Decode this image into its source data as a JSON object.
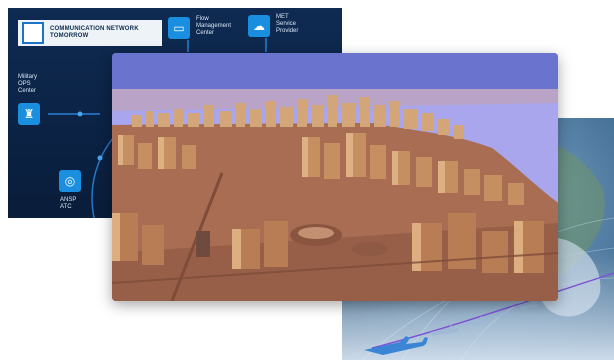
{
  "network_panel": {
    "header_line1": "COMMUNICATION NETWORK",
    "header_line2": "TOMORROW",
    "nodes": [
      {
        "label_lines": [
          "Flow",
          "Management",
          "Center"
        ],
        "icon": "monitor-icon"
      },
      {
        "label_lines": [
          "MET",
          "Service",
          "Provider"
        ],
        "icon": "cloud-icon"
      },
      {
        "label_lines": [
          "Military",
          "OPS",
          "Center"
        ],
        "icon": "military-icon"
      },
      {
        "label_lines": [
          "ANSP",
          "ATC"
        ],
        "icon": "satellite-dish-icon"
      }
    ]
  },
  "city_panel": {
    "colors": {
      "sky": "#5d67c9",
      "water": "#a8a4f0",
      "buildings": "#c99a6c",
      "ground": "#a76b4f"
    }
  },
  "globe_panel": {
    "colors": {
      "ocean": "#5d86ab",
      "flight_path": "#7b4fd6",
      "aircraft": "#3a86d4"
    }
  }
}
